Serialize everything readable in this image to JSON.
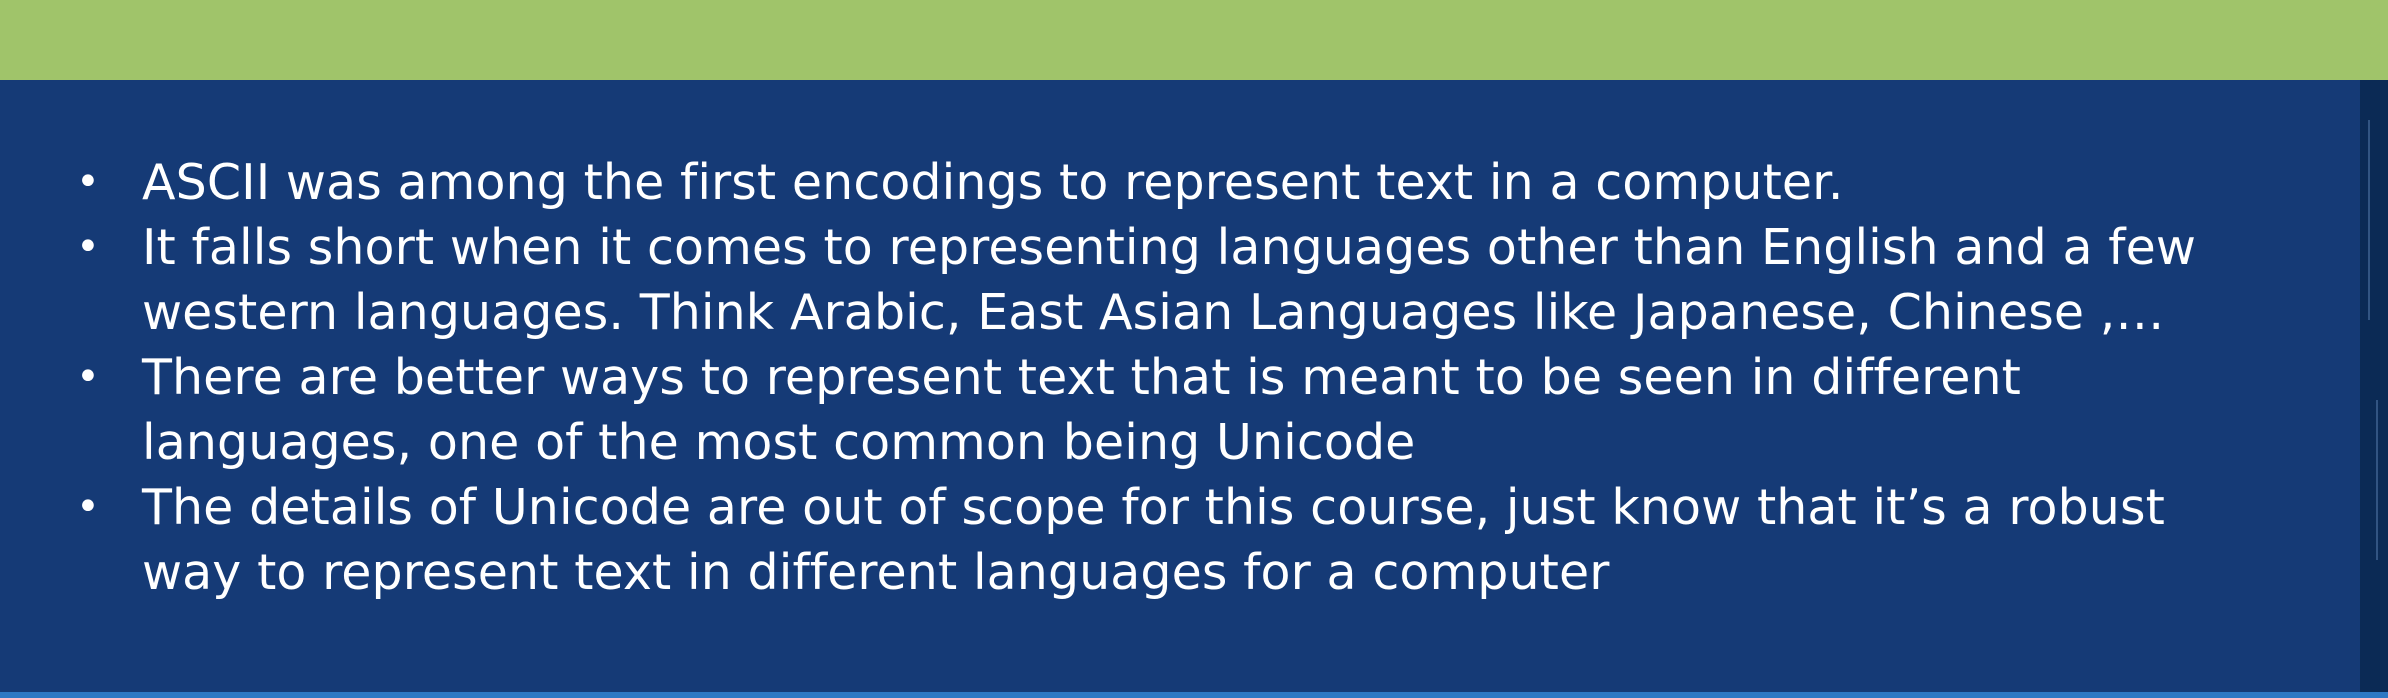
{
  "slide": {
    "bullets": [
      {
        "text_lines": [
          "ASCII was among the first encodings to represent text in a computer."
        ]
      },
      {
        "text_lines": [
          "It falls short when it comes to representing languages other than English and a few",
          "western languages. Think Arabic, East Asian Languages like Japanese, Chinese ,…"
        ]
      },
      {
        "text_lines": [
          "There are better ways to represent text that is meant to be seen in different",
          "languages, one of the most common being Unicode"
        ]
      },
      {
        "text_lines": [
          "The details of Unicode are out of scope for this course, just know that it’s a robust",
          "way to represent text in different languages for a computer"
        ]
      }
    ],
    "bullet_glyph": "•"
  },
  "theme": {
    "header_color": "#a0c46a",
    "background_color": "#153a76",
    "text_color": "#ffffff"
  }
}
